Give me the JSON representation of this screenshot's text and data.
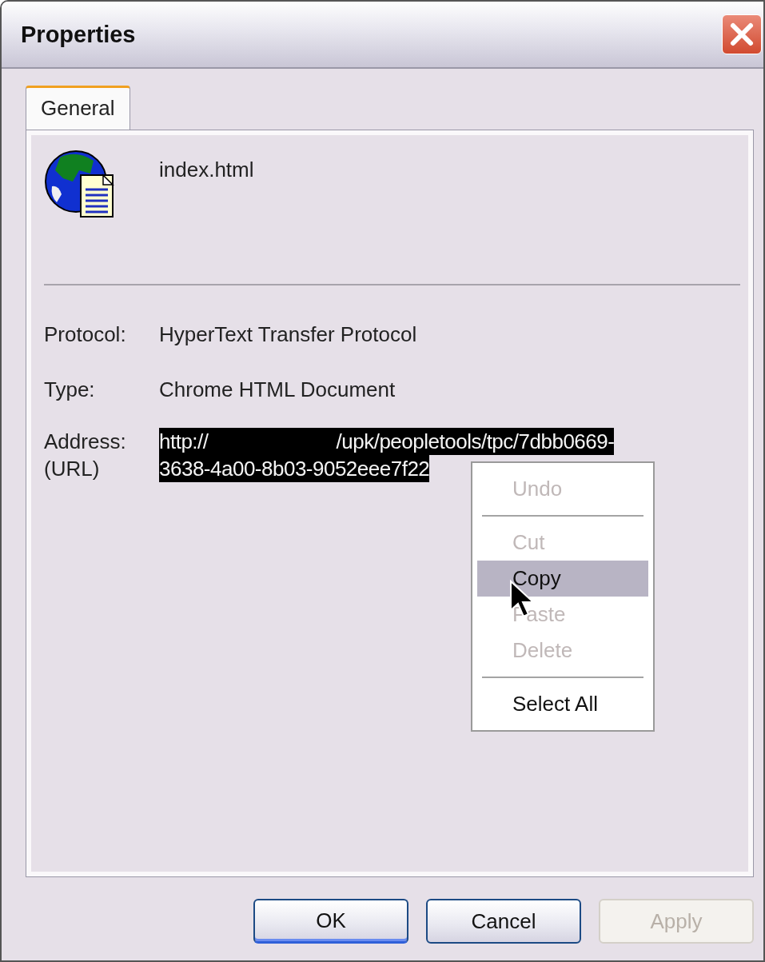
{
  "window": {
    "title": "Properties"
  },
  "tabs": [
    {
      "label": "General",
      "selected": true
    }
  ],
  "file": {
    "name": "index.html"
  },
  "fields": [
    {
      "label": "Protocol:",
      "value": "HyperText Transfer Protocol"
    },
    {
      "label": "Type:",
      "value": "Chrome HTML Document"
    }
  ],
  "address": {
    "label": "Address:",
    "label_2": "(URL)",
    "line_1_start": "http://",
    "redacted": true,
    "line_1_end": "/upk/peopletools/tpc/7dbb0669-",
    "line_2": "3638-4a00-8b03-9052eee7f22"
  },
  "context_menu": [
    {
      "kind": "item",
      "label": "Undo",
      "disabled": true,
      "selected": false
    },
    {
      "kind": "separator"
    },
    {
      "kind": "item",
      "label": "Cut",
      "disabled": true,
      "selected": false
    },
    {
      "kind": "item",
      "label": "Copy",
      "disabled": false,
      "selected": true
    },
    {
      "kind": "item",
      "label": "Paste",
      "disabled": true,
      "selected": false
    },
    {
      "kind": "item",
      "label": "Delete",
      "disabled": true,
      "selected": false
    },
    {
      "kind": "separator"
    },
    {
      "kind": "item",
      "label": "Select All",
      "disabled": false,
      "selected": false
    }
  ],
  "buttons": [
    {
      "label": "OK",
      "default": true,
      "disabled": false
    },
    {
      "label": "Cancel",
      "default": false,
      "disabled": false
    },
    {
      "label": "Apply",
      "default": false,
      "disabled": true
    }
  ]
}
